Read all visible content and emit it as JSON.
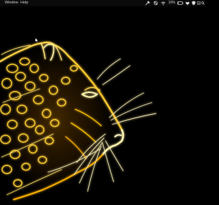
{
  "menubar": {
    "items": [
      {
        "label": "Window"
      },
      {
        "label": "Help"
      }
    ],
    "status_icons": [
      "tools-icon",
      "no-sync-icon",
      "wifi-icon",
      "battery-icon",
      "heart-icon",
      "shield-icon",
      "dropdown-icon",
      "search-icon"
    ],
    "battery_text": "10%"
  },
  "desktop": {
    "wallpaper": "glowing-leopard-fractal",
    "colors": {
      "background": "#000000",
      "glow_bright": "#fff6b0",
      "glow_mid": "#ffc400",
      "glow_deep": "#c97a00"
    }
  }
}
